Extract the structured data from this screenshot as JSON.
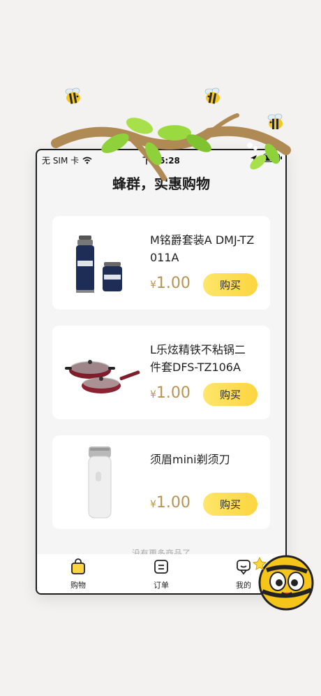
{
  "status_bar": {
    "carrier": "无 SIM 卡",
    "time": "下午5:28"
  },
  "page_title": "蜂群，实惠购物",
  "products": [
    {
      "name": "M铭爵套装A DMJ-TZ011A",
      "currency": "¥",
      "price": "1.00",
      "buy_label": "购买",
      "image": "thermos-set"
    },
    {
      "name": "L乐炫精铁不粘锅二件套DFS-TZ106A",
      "currency": "¥",
      "price": "1.00",
      "buy_label": "购买",
      "image": "red-pan-set"
    },
    {
      "name": "须眉mini剃须刀",
      "currency": "¥",
      "price": "1.00",
      "buy_label": "购买",
      "image": "white-shaver"
    }
  ],
  "footer_text": "没有更多商品了",
  "tabs": [
    {
      "label": "购物",
      "icon": "shopping-bag-icon",
      "active": true
    },
    {
      "label": "订单",
      "icon": "order-icon",
      "active": false
    },
    {
      "label": "我的",
      "icon": "profile-icon",
      "active": false
    }
  ],
  "colors": {
    "accent": "#fcd540",
    "price": "#b79455",
    "background": "#f3f2f0"
  }
}
